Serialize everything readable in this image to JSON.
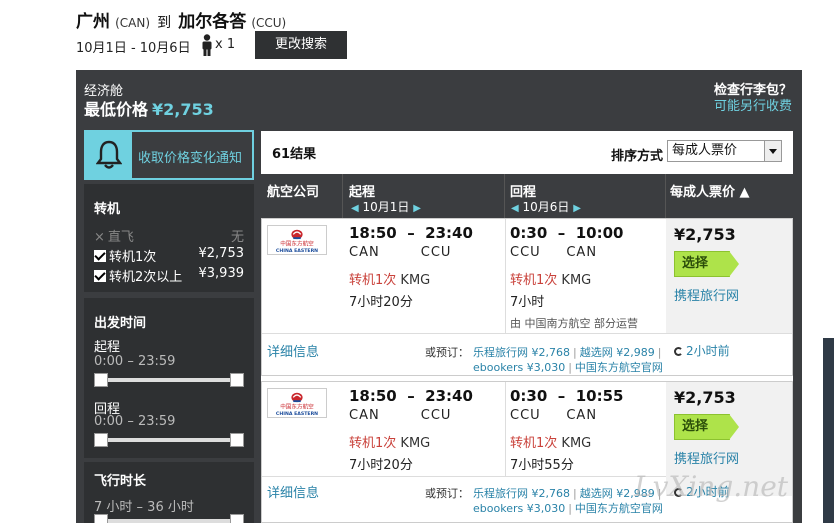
{
  "header": {
    "origin_city": "广州",
    "origin_code": "(CAN)",
    "to": "到",
    "dest_city": "加尔各答",
    "dest_code": "(CCU)",
    "dates": "10月1日 - 10月6日",
    "passengers": "x 1",
    "modify_label": "更改搜索"
  },
  "summary": {
    "cabin": "经济舱",
    "lowest_label": "最低价格",
    "lowest_price": "¥2,753",
    "baggage_question": "检查行李包？",
    "baggage_link": "可能另行收费"
  },
  "alert": {
    "label": "收取价格变化通知"
  },
  "filters": {
    "stops_title": "转机",
    "stops": [
      {
        "label": "直飞",
        "value": "无",
        "checked": false
      },
      {
        "label": "转机1次",
        "value": "¥2,753",
        "checked": true
      },
      {
        "label": "转机2次以上",
        "value": "¥3,939",
        "checked": true
      }
    ],
    "depart_title": "出发时间",
    "outbound_label": "起程",
    "outbound_range": "0:00 – 23:59",
    "return_label": "回程",
    "return_range": "0:00 – 23:59",
    "duration_title": "飞行时长",
    "duration_range": "7 小时 – 36 小时"
  },
  "results": {
    "count": "61结果",
    "sort_label": "排序方式",
    "sort_value": "每成人票价",
    "col_airline": "航空公司",
    "col_outbound": "起程",
    "col_outbound_date": "10月1日",
    "col_return": "回程",
    "col_return_date": "10月6日",
    "col_price": "每成人票价 ▲",
    "flights": [
      {
        "airline_logo_cn": "中国东方航空",
        "airline_logo_en": "CHINA EASTERN",
        "out_dep": "18:50",
        "out_arr": "23:40",
        "out_from": "CAN",
        "out_to": "CCU",
        "out_stops": "转机1次",
        "out_via": "KMG",
        "out_dur": "7小时20分",
        "ret_dep": "0:30",
        "ret_arr": "10:00",
        "ret_from": "CCU",
        "ret_to": "CAN",
        "ret_stops": "转机1次",
        "ret_via": "KMG",
        "ret_dur": "7小时",
        "operated": "由 中国南方航空 部分运营",
        "price": "¥2,753",
        "select_label": "选择",
        "agent": "携程旅行网",
        "details": "详细信息",
        "book_label": "或预订：",
        "vendors_line1": [
          "乐程旅行网 ¥2,768",
          "越选网 ¥2,989"
        ],
        "vendors_line2": [
          "ebookers ¥3,030",
          "中国东方航空官网"
        ],
        "ago": "2小时前"
      },
      {
        "airline_logo_cn": "中国东方航空",
        "airline_logo_en": "CHINA EASTERN",
        "out_dep": "18:50",
        "out_arr": "23:40",
        "out_from": "CAN",
        "out_to": "CCU",
        "out_stops": "转机1次",
        "out_via": "KMG",
        "out_dur": "7小时20分",
        "ret_dep": "0:30",
        "ret_arr": "10:55",
        "ret_from": "CCU",
        "ret_to": "CAN",
        "ret_stops": "转机1次",
        "ret_via": "KMG",
        "ret_dur": "7小时55分",
        "price": "¥2,753",
        "select_label": "选择",
        "agent": "携程旅行网",
        "details": "详细信息",
        "book_label": "或预订：",
        "vendors_line1": [
          "乐程旅行网 ¥2,768",
          "越选网 ¥2,989"
        ],
        "vendors_line2": [
          "ebookers ¥3,030",
          "中国东方航空官网"
        ],
        "ago": "2小时前"
      }
    ]
  },
  "watermark": "LvXing.net"
}
